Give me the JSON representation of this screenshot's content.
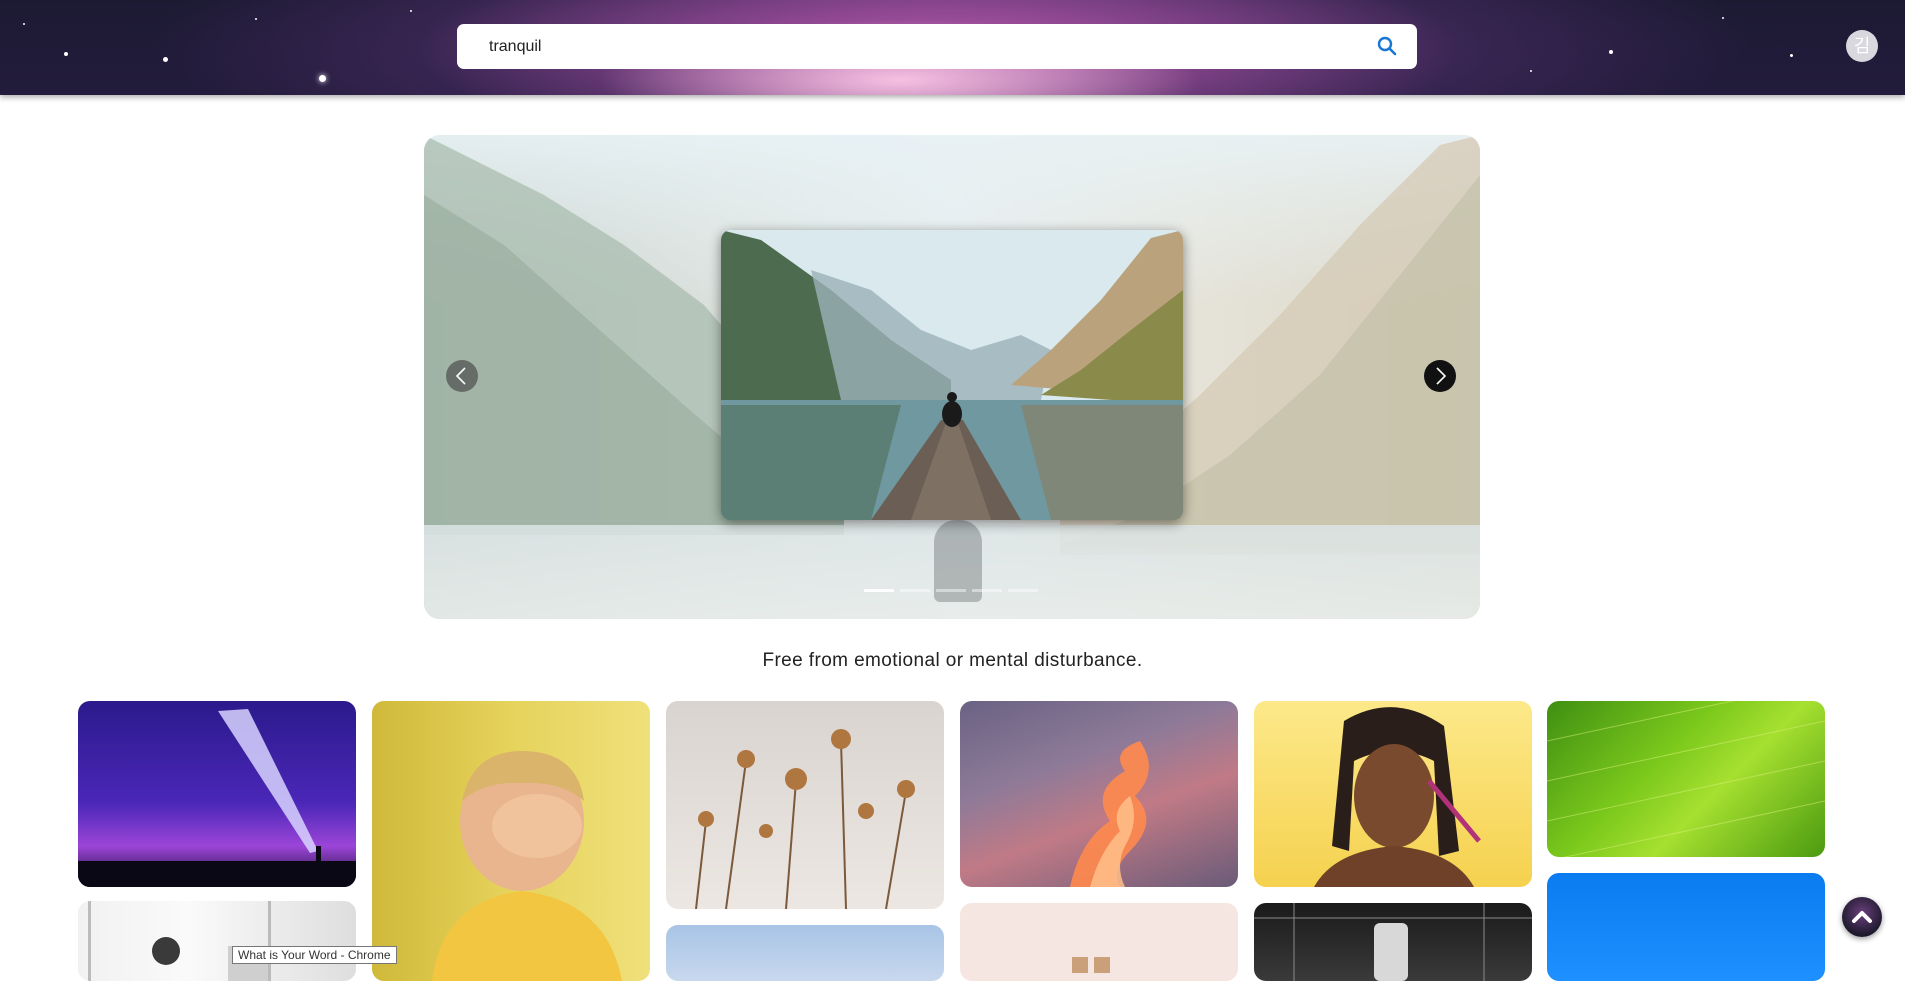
{
  "header": {
    "search": {
      "value": "tranquil",
      "placeholder": ""
    },
    "search_icon": "search-icon",
    "avatar_initial": "김"
  },
  "carousel": {
    "slide_count": 5,
    "active_slide": 1,
    "prev_icon": "chevron-left-icon",
    "next_icon": "chevron-right-icon"
  },
  "definition": "Free from emotional or mental disturbance.",
  "gallery": {
    "items": [
      {
        "name": "comet-night-sky"
      },
      {
        "name": "child-covering-eyes"
      },
      {
        "name": "dried-flowers"
      },
      {
        "name": "sunset-clouds"
      },
      {
        "name": "woman-makeup-yellow"
      },
      {
        "name": "green-leaf"
      },
      {
        "name": "office-room"
      },
      {
        "name": "blue-sky-pastel"
      },
      {
        "name": "pink-blocks"
      },
      {
        "name": "boxing-gym"
      },
      {
        "name": "blue-gradient"
      }
    ]
  },
  "scroll_top_icon": "arrow-up-icon",
  "tooltip": "What is Your Word - Chrome",
  "colors": {
    "accent": "#1976d2",
    "header_dark": "#1c1a33",
    "header_glow": "#c45aa8"
  }
}
